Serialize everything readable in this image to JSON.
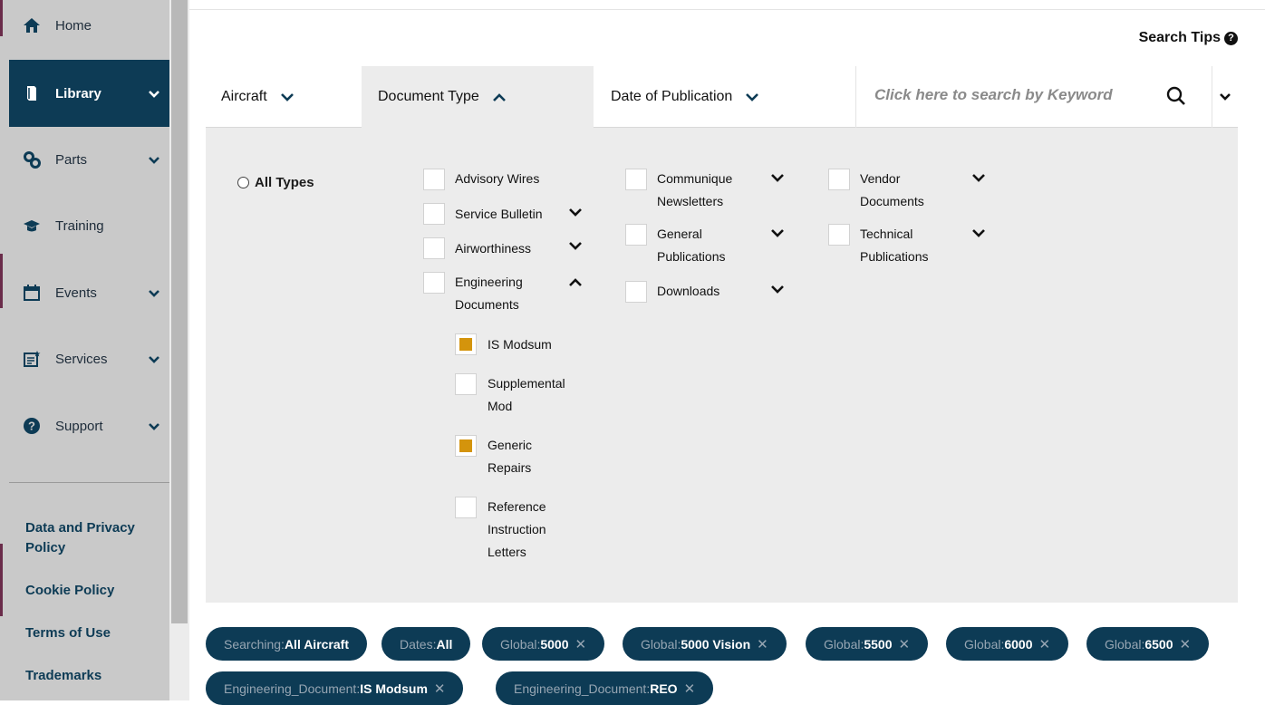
{
  "colors": {
    "navy": "#0d3b55",
    "sidebar": "#c9c9c9",
    "panel": "#ececec",
    "checked": "#d4940c"
  },
  "sidebar": {
    "items": [
      {
        "label": "Home",
        "icon": "home-icon"
      },
      {
        "label": "Library",
        "icon": "book-icon",
        "active": true
      },
      {
        "label": "Parts",
        "icon": "parts-icon"
      },
      {
        "label": "Training",
        "icon": "graduation-cap-icon"
      },
      {
        "label": "Events",
        "icon": "calendar-icon"
      },
      {
        "label": "Services",
        "icon": "services-icon"
      },
      {
        "label": "Support",
        "icon": "question-circle-icon"
      }
    ],
    "footer_links": [
      "Data and Privacy Policy",
      "Cookie Policy",
      "Terms of Use",
      "Trademarks"
    ]
  },
  "header": {
    "search_tips": "Search Tips"
  },
  "filters": {
    "tabs": [
      "Aircraft",
      "Document Type",
      "Date of Publication"
    ],
    "active_tab": "Document Type",
    "search_placeholder": "Click here to search by Keyword"
  },
  "doc_types": {
    "all_types": "All Types",
    "col1": [
      "Advisory Wires",
      "Service Bulletin",
      "Airworthiness",
      "Engineering Documents"
    ],
    "engineering_sub": [
      {
        "label": "IS Modsum",
        "checked": true
      },
      {
        "label": "Supplemental Mod",
        "checked": false
      },
      {
        "label": "Generic Repairs",
        "checked": true
      },
      {
        "label": "Reference Instruction Letters",
        "checked": false
      }
    ],
    "col2": [
      "Communique Newsletters",
      "General Publications",
      "Downloads"
    ],
    "col3": [
      "Vendor Documents",
      "Technical Publications"
    ]
  },
  "pills": [
    {
      "key": "Searching: ",
      "value": "All Aircraft",
      "removable": false
    },
    {
      "key": "Dates: ",
      "value": "All",
      "removable": false
    },
    {
      "key": "Global: ",
      "value": "5000",
      "removable": true
    },
    {
      "key": "Global: ",
      "value": "5000 Vision",
      "removable": true
    },
    {
      "key": "Global: ",
      "value": "5500",
      "removable": true
    },
    {
      "key": "Global: ",
      "value": "6000",
      "removable": true
    },
    {
      "key": "Global: ",
      "value": "6500",
      "removable": true
    },
    {
      "key": "Engineering_Document: ",
      "value": "IS Modsum",
      "removable": true
    },
    {
      "key": "Engineering_Document: ",
      "value": "REO",
      "removable": true
    }
  ],
  "remove_glyph": "✕"
}
